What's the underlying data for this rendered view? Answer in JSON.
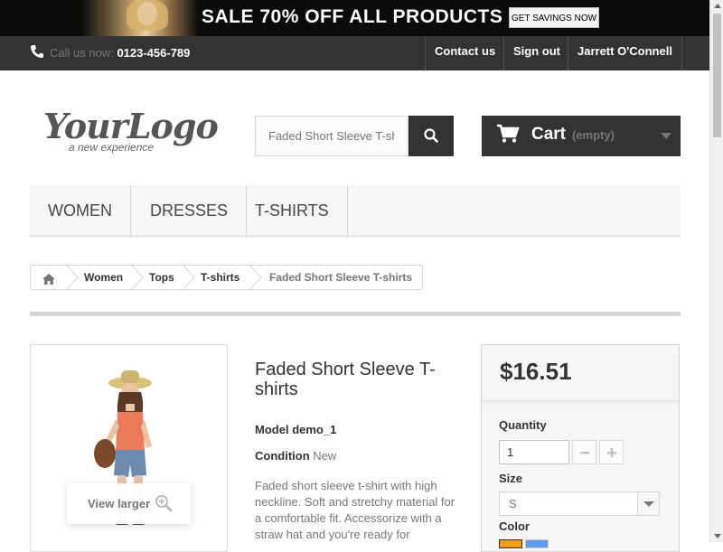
{
  "promo": {
    "text": "SALE 70% OFF ALL PRODUCTS",
    "button": "GET SAVINGS NOW"
  },
  "topnav": {
    "call_label": "Call us now:",
    "phone": "0123-456-789",
    "links": [
      "Contact us",
      "Sign out",
      "Jarrett O'Connell"
    ]
  },
  "logo": {
    "text": "YourLogo",
    "tagline": "a new experience"
  },
  "search": {
    "value": "Faded Short Sleeve T-shirt"
  },
  "cart": {
    "label": "Cart",
    "status": "(empty)"
  },
  "menu": {
    "items": [
      "Women",
      "Dresses",
      "T-shirts"
    ]
  },
  "breadcrumb": {
    "items": [
      "Women",
      "Tops",
      "T-shirts",
      "Faded Short Sleeve T-shirts"
    ]
  },
  "product": {
    "view_larger": "View larger",
    "title": "Faded Short Sleeve T-shirts",
    "model_label": "Model",
    "model_value": "demo_1",
    "condition_label": "Condition",
    "condition_value": "New",
    "description": "Faded short sleeve t-shirt with high neckline. Soft and stretchy material for a comfortable fit. Accessorize with a straw hat and you're ready for"
  },
  "buy": {
    "price": "$16.51",
    "quantity_label": "Quantity",
    "quantity_value": "1",
    "size_label": "Size",
    "size_value": "S",
    "color_label": "Color",
    "colors": [
      "#f39c11",
      "#5d9cec"
    ]
  }
}
